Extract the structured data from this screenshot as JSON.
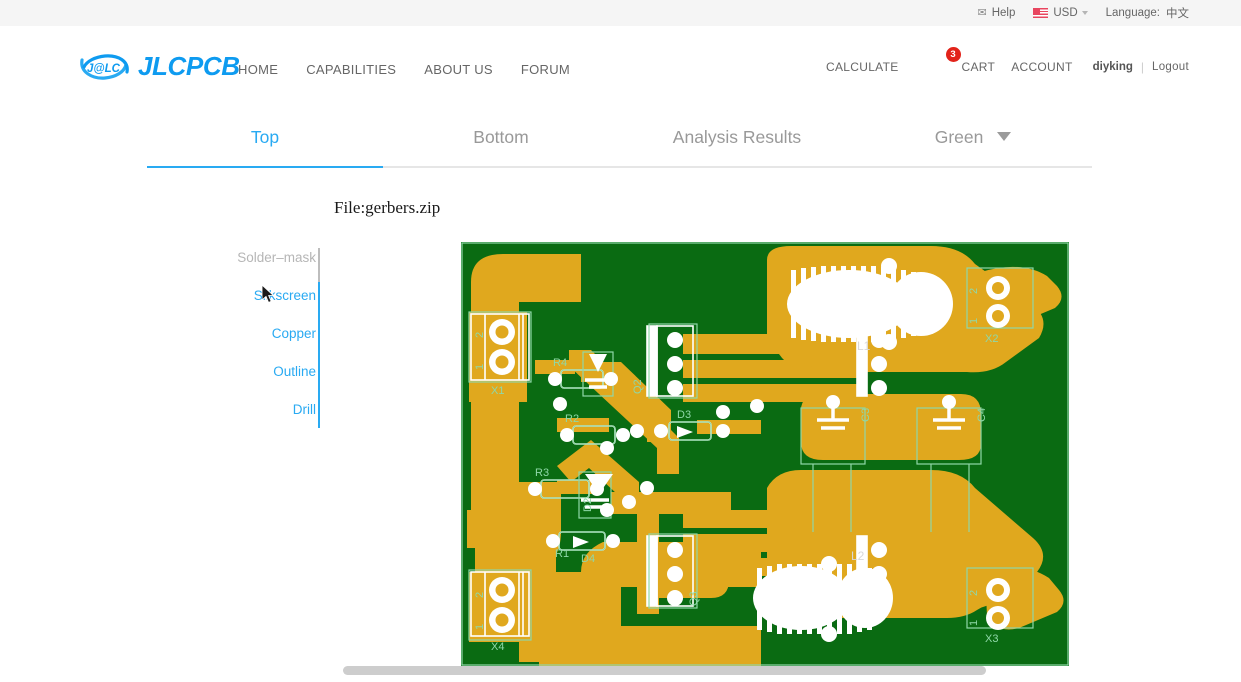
{
  "utility_bar": {
    "mail_icon": "mail-icon",
    "help_label": "Help",
    "flag_icon": "us-flag-icon",
    "currency_label": "USD",
    "currency_caret": "chevron-down-icon",
    "language_label": "Language:",
    "language_value": "中文"
  },
  "header": {
    "logo_icon": "jlc-swoosh-logo",
    "logo_mark_text": "J@LC",
    "logo_text": "JLCPCB",
    "nav": [
      {
        "label": "HOME"
      },
      {
        "label": "CAPABILITIES"
      },
      {
        "label": "ABOUT US"
      },
      {
        "label": "FORUM"
      }
    ],
    "calculate_label": "CALCULATE",
    "cart_label": "CART",
    "cart_badge": "3",
    "account_label": "ACCOUNT",
    "username": "diyking",
    "separator": "|",
    "logout_label": "Logout"
  },
  "tabs": [
    {
      "label": "Top",
      "active": true
    },
    {
      "label": "Bottom",
      "active": false
    },
    {
      "label": "Analysis Results",
      "active": false
    },
    {
      "label": "Green",
      "active": false,
      "has_caret": true
    }
  ],
  "file": {
    "label": "File:gerbers.zip"
  },
  "layers": [
    {
      "label": "Solder–mask",
      "enabled": false
    },
    {
      "label": "Silkscreen",
      "enabled": true
    },
    {
      "label": "Copper",
      "enabled": true
    },
    {
      "label": "Outline",
      "enabled": true
    },
    {
      "label": "Drill",
      "enabled": true
    }
  ],
  "colors": {
    "accent": "#29aaf2",
    "brand": "#0e9bf0",
    "badge": "#e2231a",
    "soldermask": "#0a6b12",
    "copper": "#e0a81e",
    "silkscreen": "#ffffff",
    "outline": "#8fd8a8",
    "disabled_text": "#b6b6b6",
    "muted_text": "#999999"
  },
  "pcb": {
    "board_color_name": "Green",
    "designators": [
      "X1",
      "X2",
      "X3",
      "X4",
      "L1",
      "L2",
      "R1",
      "R2",
      "R3",
      "R4",
      "D1",
      "D2",
      "D3",
      "D4",
      "C3",
      "C4",
      "Q2",
      "Q3"
    ]
  },
  "scrollbar": {
    "name": "horizontal-scrollbar"
  }
}
